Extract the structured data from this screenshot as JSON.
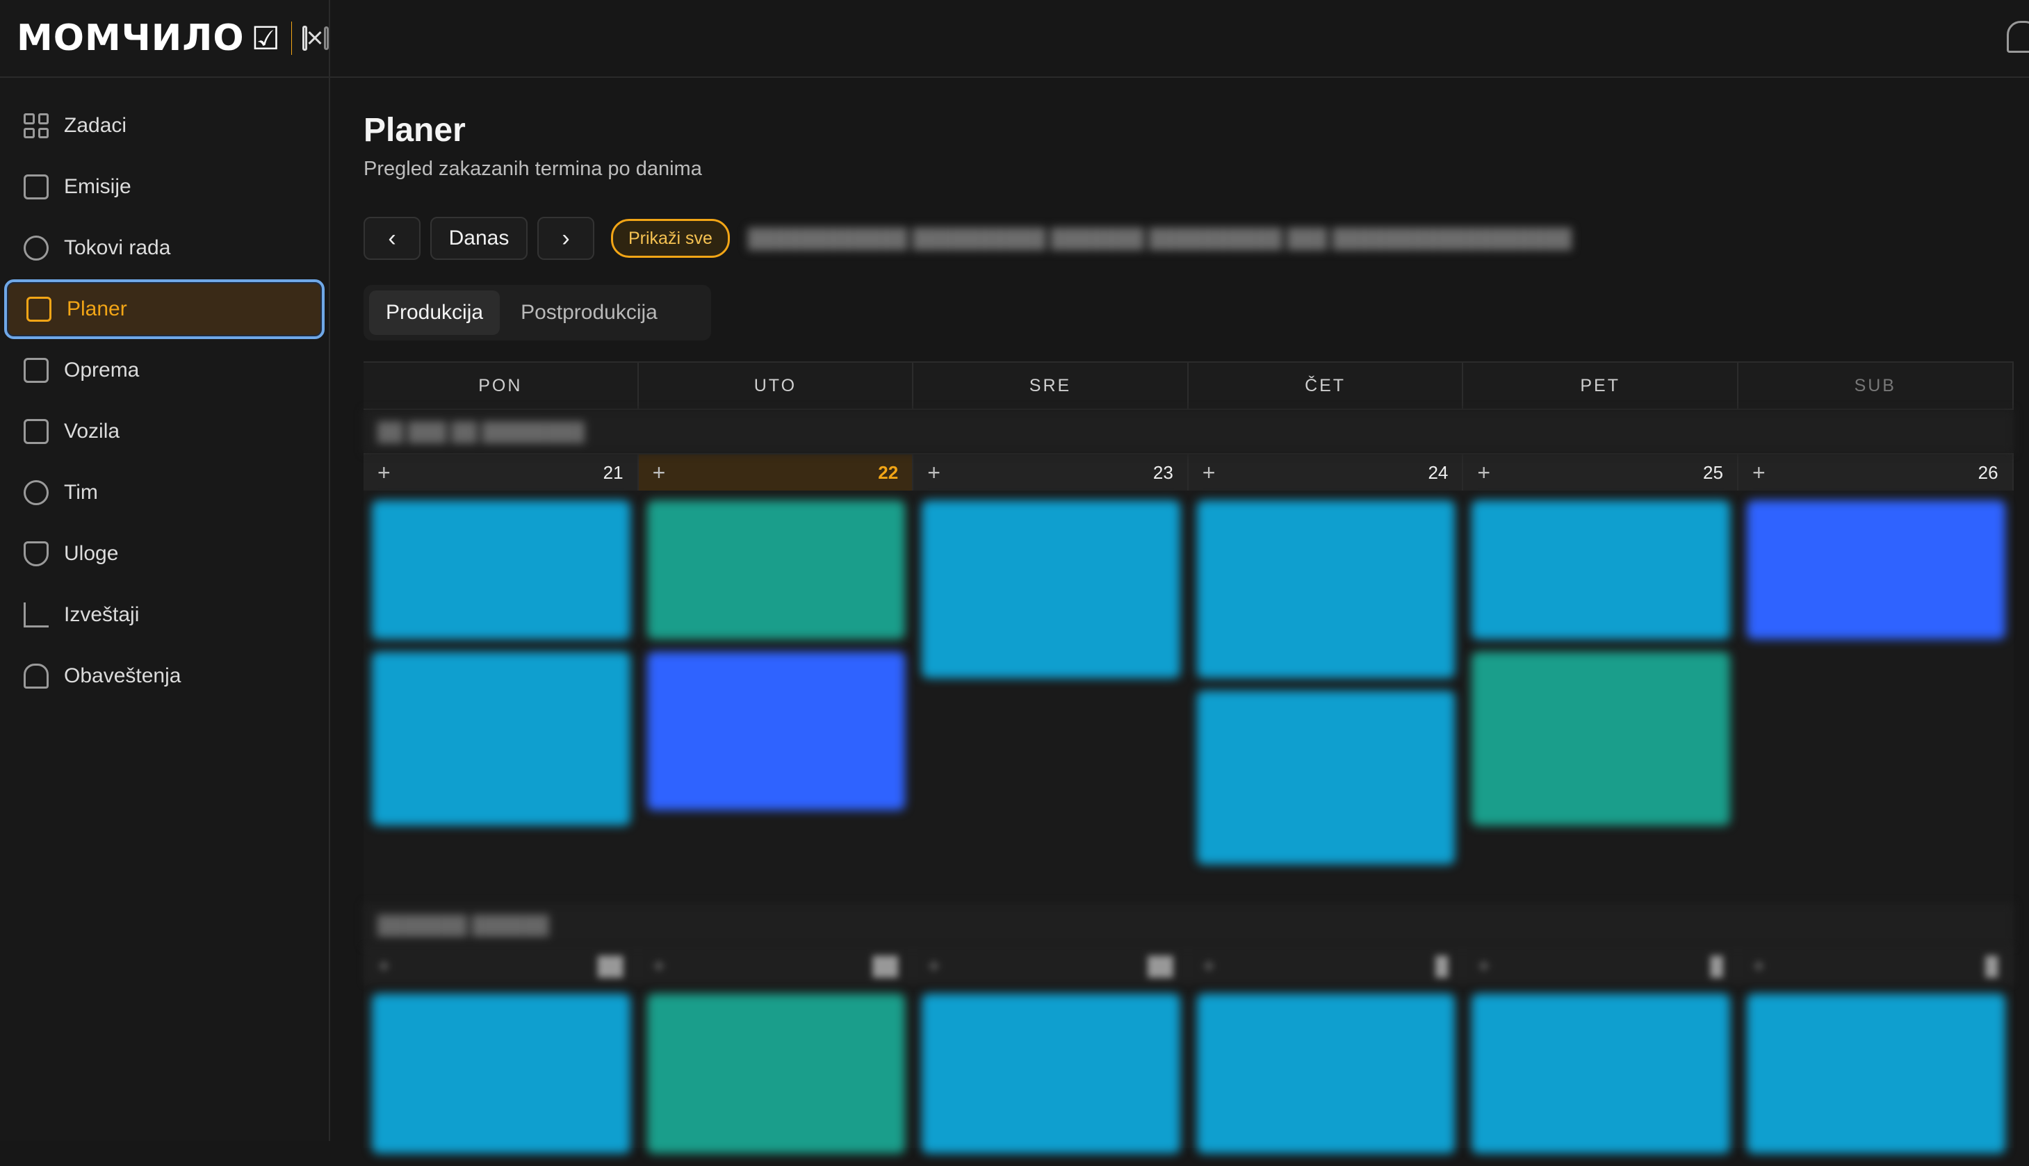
{
  "app": {
    "logo_text": "МОМЧИЛО",
    "logo_check": "☑",
    "colors": {
      "accent": "#f2a516",
      "active_border": "#6fa8e8",
      "event_cyan": "#0f9fcf",
      "event_green": "#1a9e8b",
      "event_blue": "#2f63ff"
    }
  },
  "sidebar": {
    "items": [
      {
        "label": "Zadaci",
        "icon": "grid-icon"
      },
      {
        "label": "Emisije",
        "icon": "tv-icon"
      },
      {
        "label": "Tokovi rada",
        "icon": "workflow-icon"
      },
      {
        "label": "Planer",
        "icon": "calendar-icon",
        "active": true
      },
      {
        "label": "Oprema",
        "icon": "box-icon"
      },
      {
        "label": "Vozila",
        "icon": "truck-icon"
      },
      {
        "label": "Tim",
        "icon": "users-icon"
      },
      {
        "label": "Uloge",
        "icon": "shield-icon"
      },
      {
        "label": "Izveštaji",
        "icon": "chart-icon"
      },
      {
        "label": "Obaveštenja",
        "icon": "bell-icon"
      }
    ]
  },
  "page": {
    "title": "Planer",
    "subtitle": "Pregled zakazanih termina po danima"
  },
  "toolbar": {
    "prev": "‹",
    "today": "Danas",
    "next": "›",
    "show_all": "Prikaži sve"
  },
  "tabs": [
    {
      "label": "Produkcija",
      "active": true
    },
    {
      "label": "Postprodukcija",
      "active": false
    }
  ],
  "calendar": {
    "weekdays": [
      "PON",
      "UTO",
      "SRE",
      "ČET",
      "PET",
      "SUB"
    ],
    "week1_days": [
      "21",
      "22",
      "23",
      "24",
      "25",
      "26"
    ],
    "today_index": 1
  }
}
